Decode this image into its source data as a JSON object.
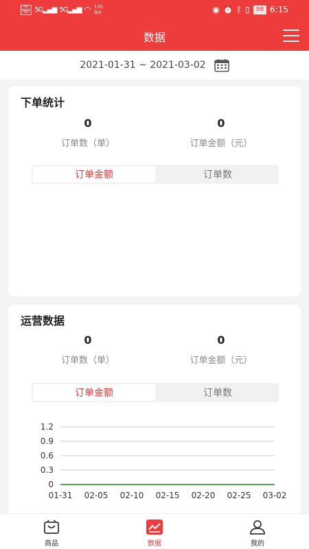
{
  "status": {
    "net_speed": "135",
    "net_unit": "B/s",
    "battery": "98",
    "time": "6:15",
    "sim1": "HD",
    "sim2": "HD",
    "sig1": "5G",
    "sig2": "5G"
  },
  "nav": {
    "title": "数据"
  },
  "date_range": "2021-01-31 ~ 2021-03-02",
  "order_stats": {
    "title": "下单统计",
    "order_count": "0",
    "order_count_label": "订单数（单）",
    "order_amount": "0",
    "order_amount_label": "订单金额（元）",
    "tabs": [
      "订单金额",
      "订单数"
    ]
  },
  "ops_stats": {
    "title": "运营数据",
    "order_count": "0",
    "order_count_label": "订单数（单）",
    "order_amount": "0",
    "order_amount_label": "订单金额（元）",
    "tabs": [
      "订单金额",
      "订单数"
    ]
  },
  "chart_data": {
    "type": "line",
    "x": [
      "01-31",
      "02-05",
      "02-10",
      "02-15",
      "02-20",
      "02-25",
      "03-02"
    ],
    "y_ticks": [
      "1.2",
      "0.9",
      "0.6",
      "0.3",
      "0"
    ],
    "ylim": [
      0,
      1.2
    ],
    "grid": true,
    "series": [
      {
        "values": [
          0,
          0,
          0,
          0,
          0,
          0,
          0
        ]
      }
    ],
    "line_color": "#4caf50"
  },
  "tabbar": {
    "items": [
      "商品",
      "数据",
      "我的"
    ]
  },
  "colors": {
    "brand": "#ee3b3b",
    "accent": "#e03a3a"
  }
}
